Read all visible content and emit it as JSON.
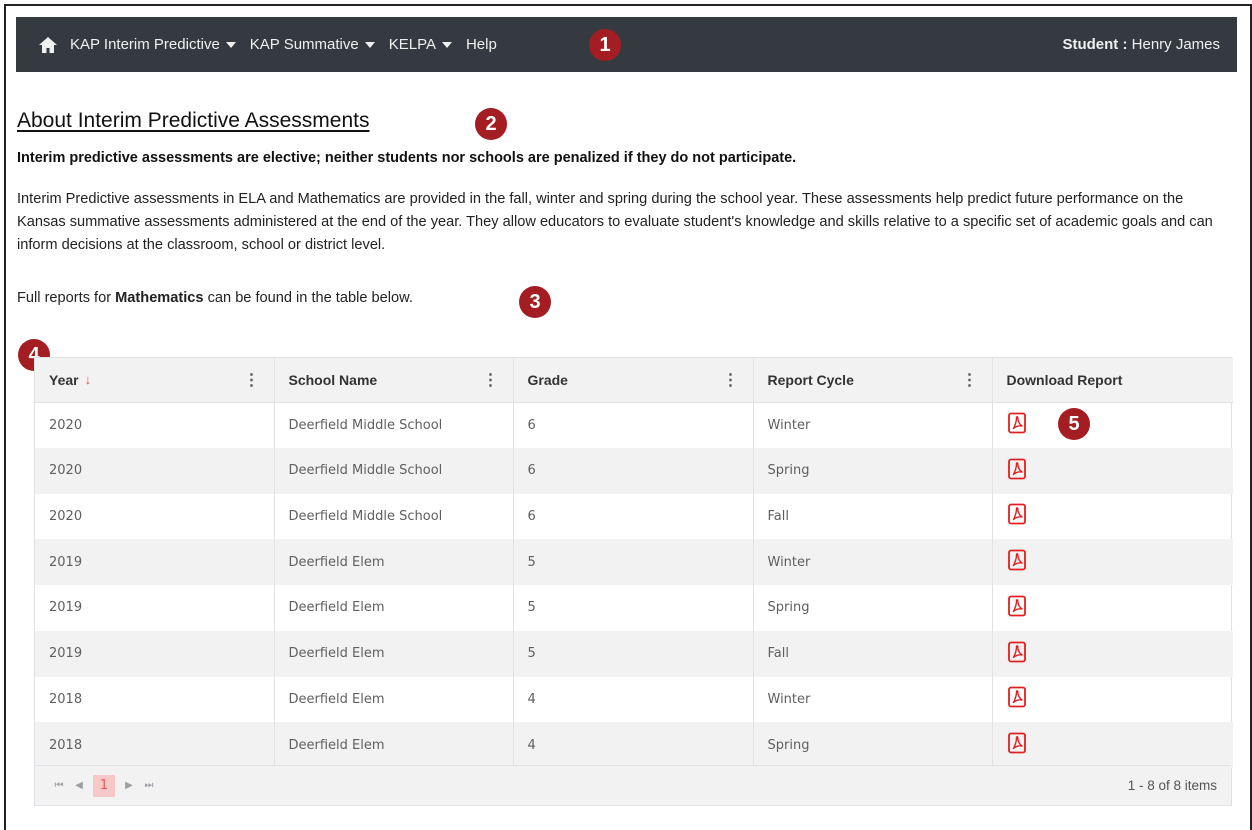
{
  "nav": {
    "home_icon": "home-icon",
    "items": [
      {
        "label": "KAP Interim Predictive"
      },
      {
        "label": "KAP Summative"
      },
      {
        "label": "KELPA"
      }
    ],
    "help_label": "Help",
    "user_prefix": "Student :",
    "user_name": "Henry James"
  },
  "content": {
    "title": "About Interim Predictive Assessments",
    "notice": "Interim predictive assessments are elective; neither students nor schools are penalized if they do not participate.",
    "intro": "Interim Predictive assessments in ELA and Mathematics are provided in the fall, winter and spring during the school year. These assessments help predict future performance on the Kansas summative assessments administered at the end of the year. They allow educators to evaluate student's knowledge and skills relative to a specific set of academic goals and can inform decisions at the classroom, school or district level.",
    "reports_prefix": "Full reports for",
    "reports_subject": "Mathematics",
    "reports_suffix": "can be found in the table below."
  },
  "callouts": [
    "1",
    "2",
    "3",
    "4",
    "5"
  ],
  "table": {
    "columns": [
      "Year",
      "School Name",
      "Grade",
      "Report Cycle",
      "Download Report"
    ],
    "sort_indicator": "↓",
    "menu_glyph": "⋮",
    "download_icon": "pdf-icon",
    "rows": [
      {
        "year": "2020",
        "school": "Deerfield Middle School",
        "grade": "6",
        "cycle": "Winter"
      },
      {
        "year": "2020",
        "school": "Deerfield Middle School",
        "grade": "6",
        "cycle": "Spring"
      },
      {
        "year": "2020",
        "school": "Deerfield Middle School",
        "grade": "6",
        "cycle": "Fall"
      },
      {
        "year": "2019",
        "school": "Deerfield Elem",
        "grade": "5",
        "cycle": "Winter"
      },
      {
        "year": "2019",
        "school": "Deerfield Elem",
        "grade": "5",
        "cycle": "Spring"
      },
      {
        "year": "2019",
        "school": "Deerfield Elem",
        "grade": "5",
        "cycle": "Fall"
      },
      {
        "year": "2018",
        "school": "Deerfield Elem",
        "grade": "4",
        "cycle": "Winter"
      },
      {
        "year": "2018",
        "school": "Deerfield Elem",
        "grade": "4",
        "cycle": "Spring"
      }
    ]
  },
  "pager": {
    "first": "⏮",
    "prev": "◀",
    "current_page": "1",
    "next": "▶",
    "last": "⏭",
    "info": "1 - 8 of 8 items"
  },
  "colors": {
    "navbar": "#343a40",
    "callout": "#a31d22",
    "pdf": "#e02020",
    "row_alt": "#f2f2f2"
  }
}
